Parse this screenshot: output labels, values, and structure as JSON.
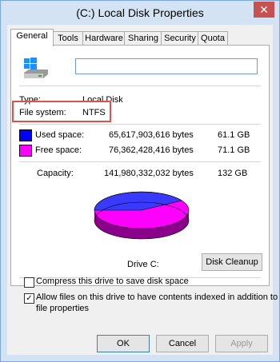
{
  "window": {
    "title": "(C:) Local Disk Properties",
    "close_glyph": "✕"
  },
  "tabs": [
    "General",
    "Tools",
    "Hardware",
    "Sharing",
    "Security",
    "Quota"
  ],
  "general": {
    "name_value": "",
    "type_label": "Type:",
    "type_value": "Local Disk",
    "fs_label": "File system:",
    "fs_value": "NTFS",
    "used_label": "Used space:",
    "used_bytes": "65,617,903,616 bytes",
    "used_gb": "61.1 GB",
    "free_label": "Free space:",
    "free_bytes": "76,362,428,416 bytes",
    "free_gb": "71.1 GB",
    "cap_label": "Capacity:",
    "cap_bytes": "141,980,332,032 bytes",
    "cap_gb": "132 GB",
    "drive_label": "Drive C:",
    "cleanup_label": "Disk Cleanup",
    "compress_label": "Compress this drive to save disk space",
    "compress_checked": false,
    "index_label_1": "Allow files on this drive to have contents indexed in addition to",
    "index_label_2": "file properties",
    "index_checked": true,
    "used_color": "#0000ff",
    "free_color": "#ff00ff"
  },
  "buttons": {
    "ok": "OK",
    "cancel": "Cancel",
    "apply": "Apply"
  }
}
